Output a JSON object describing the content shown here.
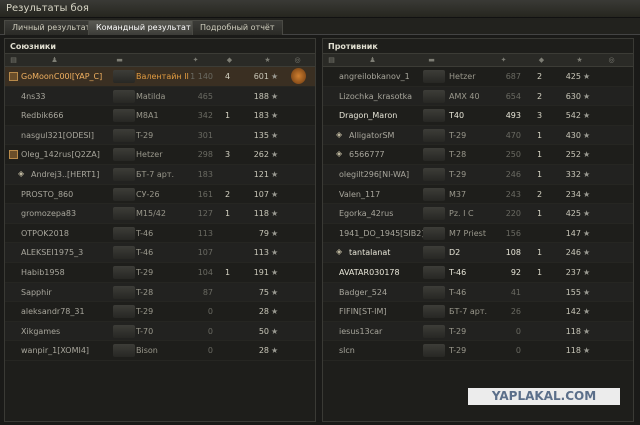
{
  "window": {
    "title": "Результаты боя"
  },
  "tabs": [
    {
      "label": "Личный результат"
    },
    {
      "label": "Командный результат",
      "active": true
    },
    {
      "label": "Подробный отчёт"
    }
  ],
  "allies": {
    "title": "Союзники",
    "rows": [
      {
        "name": "GoMoonC00l[YAP_C]",
        "tank": "Валентайн II",
        "dmg": "1 140",
        "kills": "4",
        "xp": "601",
        "self": true,
        "medal": "medal-icon"
      },
      {
        "name": "4ns33",
        "tank": "Matilda",
        "dmg": "465",
        "kills": "",
        "xp": "188"
      },
      {
        "name": "Redbik666",
        "tank": "M8A1",
        "dmg": "342",
        "kills": "1",
        "xp": "183"
      },
      {
        "name": "nasgul321[ODESI]",
        "tank": "T-29",
        "dmg": "301",
        "kills": "",
        "xp": "135"
      },
      {
        "name": "Oleg_142rus[Q2ZA]",
        "tank": "Hetzer",
        "dmg": "298",
        "kills": "3",
        "xp": "262",
        "squad": true
      },
      {
        "name": "Andrej3..[HERT1]",
        "tank": "БТ-7 арт.",
        "dmg": "183",
        "kills": "",
        "xp": "121",
        "dead_marker": true
      },
      {
        "name": "PROSTO_860",
        "tank": "СУ-26",
        "dmg": "161",
        "kills": "2",
        "xp": "107"
      },
      {
        "name": "gromozepa83",
        "tank": "M15/42",
        "dmg": "127",
        "kills": "1",
        "xp": "118"
      },
      {
        "name": "OTPOK2018",
        "tank": "T-46",
        "dmg": "113",
        "kills": "",
        "xp": "79"
      },
      {
        "name": "ALEKSEI1975_3",
        "tank": "T-46",
        "dmg": "107",
        "kills": "",
        "xp": "113"
      },
      {
        "name": "Habib1958",
        "tank": "T-29",
        "dmg": "104",
        "kills": "1",
        "xp": "191"
      },
      {
        "name": "Sapphir",
        "tank": "T-28",
        "dmg": "87",
        "kills": "",
        "xp": "75"
      },
      {
        "name": "aleksandr78_31",
        "tank": "T-29",
        "dmg": "0",
        "kills": "",
        "xp": "28"
      },
      {
        "name": "Xikgames",
        "tank": "T-70",
        "dmg": "0",
        "kills": "",
        "xp": "50"
      },
      {
        "name": "wanpir_1[XOMI4]",
        "tank": "Bison",
        "dmg": "0",
        "kills": "",
        "xp": "28"
      }
    ]
  },
  "enemies": {
    "title": "Противник",
    "rows": [
      {
        "name": "angreilobkanov_1",
        "tank": "Hetzer",
        "dmg": "687",
        "kills": "2",
        "xp": "425"
      },
      {
        "name": "Lizochka_krasotka",
        "tank": "AMX 40",
        "dmg": "654",
        "kills": "2",
        "xp": "630"
      },
      {
        "name": "Dragon_Maron",
        "tank": "T40",
        "dmg": "493",
        "kills": "3",
        "xp": "542",
        "alive": true
      },
      {
        "name": "AlligatorSM",
        "tank": "T-29",
        "dmg": "470",
        "kills": "1",
        "xp": "430",
        "dead_marker": true
      },
      {
        "name": "6566777",
        "tank": "T-28",
        "dmg": "250",
        "kills": "1",
        "xp": "252",
        "dead_marker": true
      },
      {
        "name": "olegilt296[NI-WA]",
        "tank": "T-29",
        "dmg": "246",
        "kills": "1",
        "xp": "332"
      },
      {
        "name": "Valen_117",
        "tank": "M37",
        "dmg": "243",
        "kills": "2",
        "xp": "234"
      },
      {
        "name": "Egorka_42rus",
        "tank": "Pz. I C",
        "dmg": "220",
        "kills": "1",
        "xp": "425"
      },
      {
        "name": "1941_DO_1945[SIB2]",
        "tank": "M7 Priest",
        "dmg": "156",
        "kills": "",
        "xp": "147"
      },
      {
        "name": "tantalanat",
        "tank": "D2",
        "dmg": "108",
        "kills": "1",
        "xp": "246",
        "alive": true,
        "dead_marker": true
      },
      {
        "name": "AVATAR030178",
        "tank": "T-46",
        "dmg": "92",
        "kills": "1",
        "xp": "237",
        "alive": true
      },
      {
        "name": "Badger_524",
        "tank": "T-46",
        "dmg": "41",
        "kills": "",
        "xp": "155"
      },
      {
        "name": "FIFIN[ST-IM]",
        "tank": "БТ-7 арт.",
        "dmg": "26",
        "kills": "",
        "xp": "142"
      },
      {
        "name": "iesus13car",
        "tank": "T-29",
        "dmg": "0",
        "kills": "",
        "xp": "118"
      },
      {
        "name": "slcn",
        "tank": "T-29",
        "dmg": "0",
        "kills": "",
        "xp": "118"
      }
    ]
  },
  "watermark": "YAPLAKAL.COM"
}
